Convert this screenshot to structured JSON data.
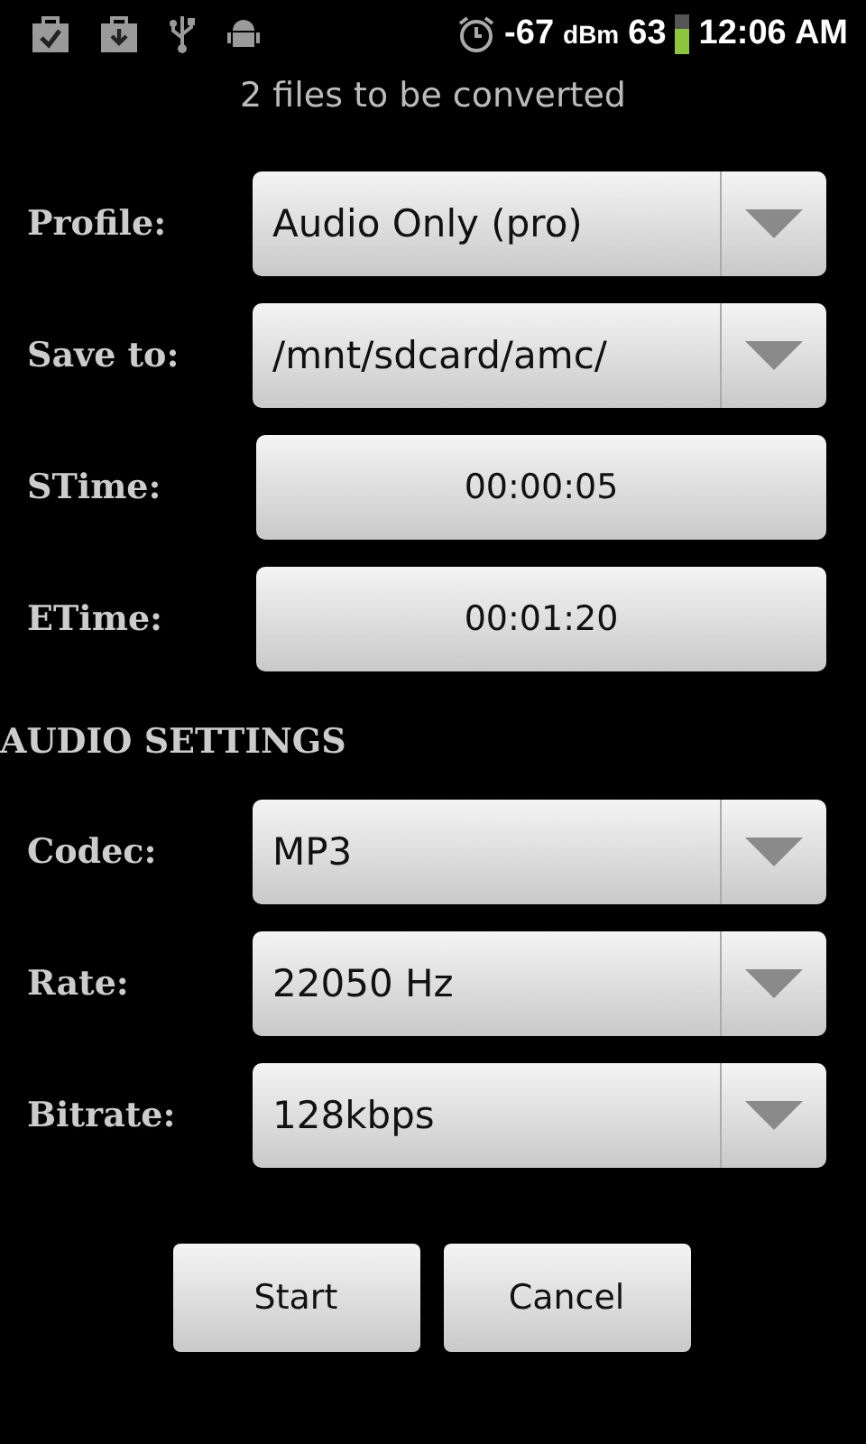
{
  "status_bar": {
    "signal": "-67",
    "signal_unit": "dBm",
    "battery": "63",
    "time": "12:06 AM"
  },
  "subtitle": "2  files to be converted",
  "rows": [
    {
      "label": "Profile:",
      "kind": "spinner",
      "value": "Audio Only (pro)"
    },
    {
      "label": "Save to:",
      "kind": "spinner",
      "value": "/mnt/sdcard/amc/"
    },
    {
      "label": "STime:",
      "kind": "time",
      "value": "00:00:05"
    },
    {
      "label": "ETime:",
      "kind": "time",
      "value": "00:01:20"
    }
  ],
  "section_title": "AUDIO SETTINGS",
  "audio_rows": [
    {
      "label": "Codec:",
      "kind": "spinner",
      "value": "MP3"
    },
    {
      "label": "Rate:",
      "kind": "spinner",
      "value": "22050 Hz"
    },
    {
      "label": "Bitrate:",
      "kind": "spinner",
      "value": "128kbps"
    }
  ],
  "buttons": [
    "Start",
    "Cancel"
  ]
}
